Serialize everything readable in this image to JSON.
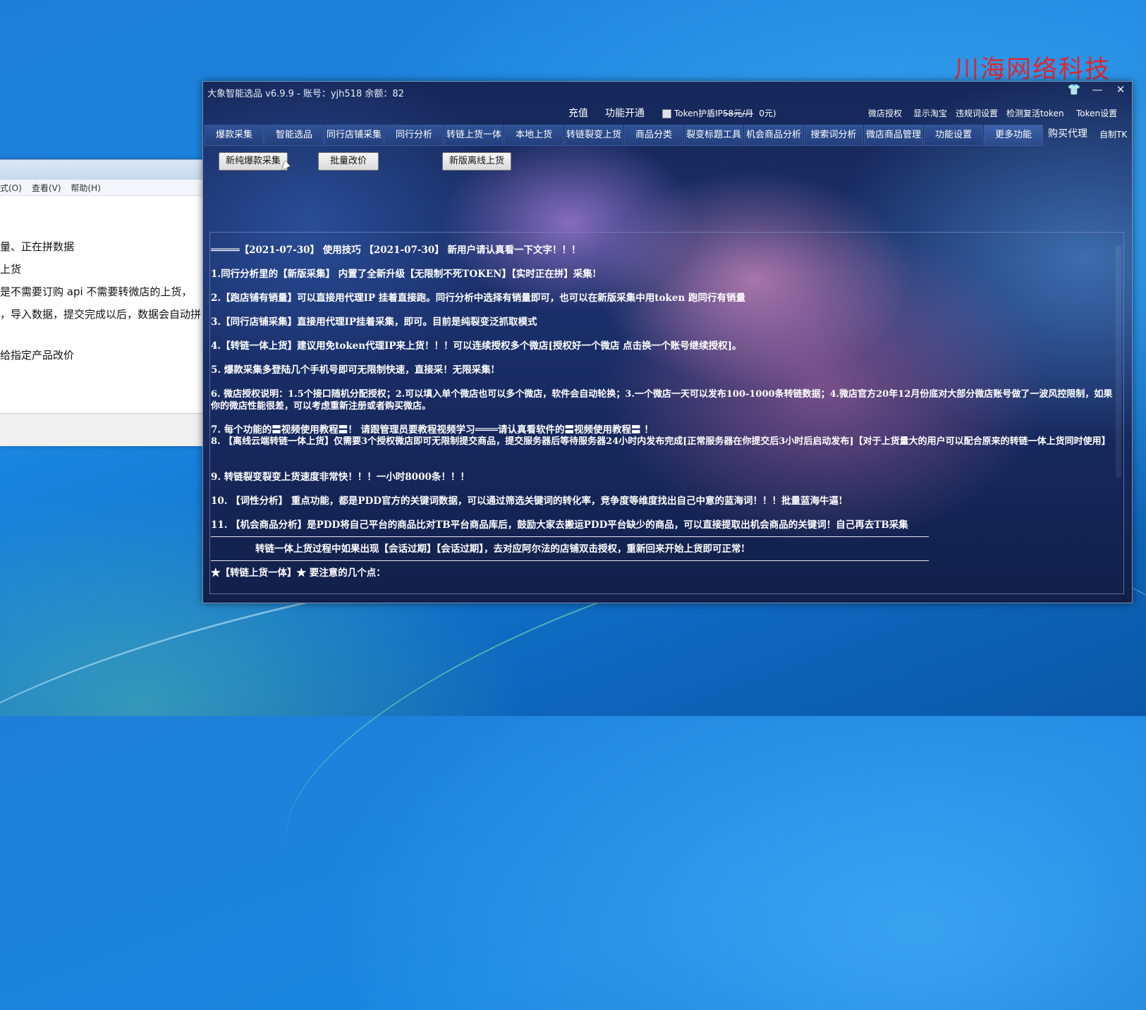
{
  "watermark": "川海网络科技",
  "background_window": {
    "menu": [
      "式(O)",
      "查看(V)",
      "帮助(H)"
    ],
    "lines": [
      "量、正在拼数据",
      "上货",
      "是不需要订购  api  不需要转微店的上货，",
      "，导入数据，提交完成以后，数据会自动拼",
      "",
      "给指定产品改价"
    ]
  },
  "app": {
    "title": "大象智能选品 v6.9.9 - 账号：yjh518 余额：82",
    "window_controls": {
      "skin": "👕",
      "minimize": "—",
      "close": "✕"
    },
    "toolbar": {
      "recharge": "充值",
      "activate": "功能开通",
      "token_ip_prefix": "Token护盾IP",
      "token_ip_old_price": "58元/月",
      "token_ip_price": "0元)",
      "shop_auth": "微店授权",
      "show_taobao": "显示淘宝",
      "violation_settings": "违规词设置",
      "check_token": "检测复活token",
      "token_settings": "Token设置"
    },
    "tabs": [
      "爆款采集",
      "智能选品",
      "同行店铺采集",
      "同行分析",
      "转链上货一体",
      "本地上货",
      "转链裂变上货",
      "商品分类",
      "裂变标题工具",
      "机会商品分析",
      "搜索词分析",
      "微店商品管理",
      "功能设置",
      "更多功能"
    ],
    "tabs_extra": {
      "buy_agent": "购买代理",
      "self_made": "自制TK"
    },
    "action_buttons": {
      "new_collect": "新纯爆款采集",
      "batch_price": "批量改价",
      "offline_upload": "新版离线上货"
    },
    "notice": {
      "header": "═════【2021-07-30】 使用技巧 【2021-07-30】  新用户请认真看一下文字！！！",
      "items": [
        "1.同行分析里的【新版采集】 内置了全新升级【无限制不死TOKEN】【实时正在拼】采集!",
        "2.【跑店铺有销量】可以直接用代理IP 挂着直接跑。同行分析中选择有销量即可，也可以在新版采集中用token 跑同行有销量",
        "3.【同行店铺采集】直接用代理IP挂着采集，即可。目前是纯裂变泛抓取模式",
        "4.【转链一体上货】建议用免token代理IP来上货！！！可以连续授权多个微店[授权好一个微店 点击换一个账号继续授权]。",
        "5. 爆款采集多登陆几个手机号即可无限制快速，直接采！无限采集!",
        "6. 微店授权说明：1.5个接口随机分配授权；2.可以填入单个微店也可以多个微店，软件会自动轮换；3.一个微店一天可以发布100-1000条转链数据；4.微店官方20年12月份底对大部分微店账号做了一波风控限制，如果你的微店性能很差，可以考虑重新注册或者购买微店。",
        "7. 每个功能的〓视频使用教程〓！ 请跟管理员要教程视频学习════请认真看软件的〓视频使用教程〓 ！",
        "8. 【离线云端转链一体上货】仅需要3个授权微店即可无限制提交商品，提交服务器后等待服务器24小时内发布完成[正常服务器在你提交后3小时后启动发布]【对于上货量大的用户可以配合原来的转链一体上货同时使用】",
        "9.  转链裂变裂变上货速度非常快！！！一小时8000条！！！",
        "10. 【词性分析】 重点功能，都是PDD官方的关键词数据，可以通过筛选关键词的转化率，竞争度等维度找出自己中意的蓝海词！！！批量蓝海牛逼!",
        "11.  【机会商品分析】是PDD将自己平台的商品比对TB平台商品库后，鼓励大家去搬运PDD平台缺少的商品，可以直接提取出机会商品的关键词！自己再去TB采集"
      ],
      "session_note": "转链一体上货过程中如果出现【会话过期】【会话过期】，去对应阿尔法的店铺双击授权，重新回来开始上货即可正常!",
      "footer": "★【转链上货一体】★  要注意的几个点："
    }
  }
}
